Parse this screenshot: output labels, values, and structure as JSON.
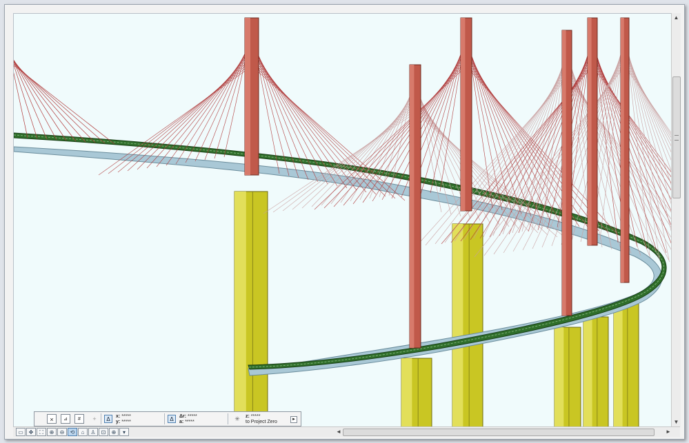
{
  "coord_box": {
    "close_label": "×",
    "x_label": "x:",
    "x_value": "*****",
    "y_label": "y:",
    "y_value": "*****",
    "dr_label": "Δr:",
    "dr_value": "*****",
    "a_label": "a:",
    "a_value": "*****",
    "z_label": "z:",
    "z_value": "*****",
    "reference_label": "to Project Zero",
    "delta_label": "Δ"
  },
  "scrollbars": {
    "up_arrow": "▲",
    "down_arrow": "▼",
    "left_arrow": "◄",
    "right_arrow": "►"
  },
  "colors": {
    "sky": "#f0fbfc",
    "deck_top": "#2f6e2a",
    "deck_side": "#a9c8d6",
    "pylon": "#c0594a",
    "pier": "#c9c623",
    "cable": "#b03a3a"
  },
  "nav_icons": [
    "layout-icon",
    "pan-icon",
    "fit-window-icon",
    "zoom-in-icon",
    "zoom-out-icon",
    "orbit-icon",
    "home-view-icon",
    "zoom-window-icon",
    "zoom-plus-icon",
    "zoom-dropdown-icon"
  ]
}
